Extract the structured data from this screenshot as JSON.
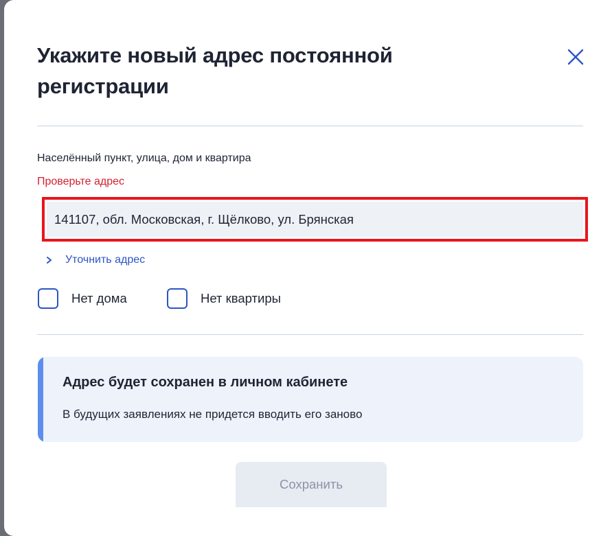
{
  "modal": {
    "title": "Укажите новый адрес постоянной регистрации",
    "close_icon": "close-icon"
  },
  "address_field": {
    "label": "Населённый пункт, улица, дом и квартира",
    "error": "Проверьте адрес",
    "value": "141107, обл. Московская, г. Щёлково, ул. Брянская",
    "state": "error"
  },
  "clarify_link": {
    "icon": "chevron-right-icon",
    "label": "Уточнить адрес"
  },
  "checkboxes": [
    {
      "label": "Нет дома",
      "checked": false
    },
    {
      "label": "Нет квартиры",
      "checked": false
    }
  ],
  "info_box": {
    "heading": "Адрес будет сохранен в личном кабинете",
    "text": "В будущих заявлениях не придется вводить его заново"
  },
  "save_button": {
    "label": "Сохранить",
    "disabled": true
  },
  "colors": {
    "accent": "#2c55c4",
    "error": "#d21f2f",
    "error_border": "#e8151c",
    "info_bar": "#5c8eee",
    "info_bg": "#edf2fb"
  }
}
